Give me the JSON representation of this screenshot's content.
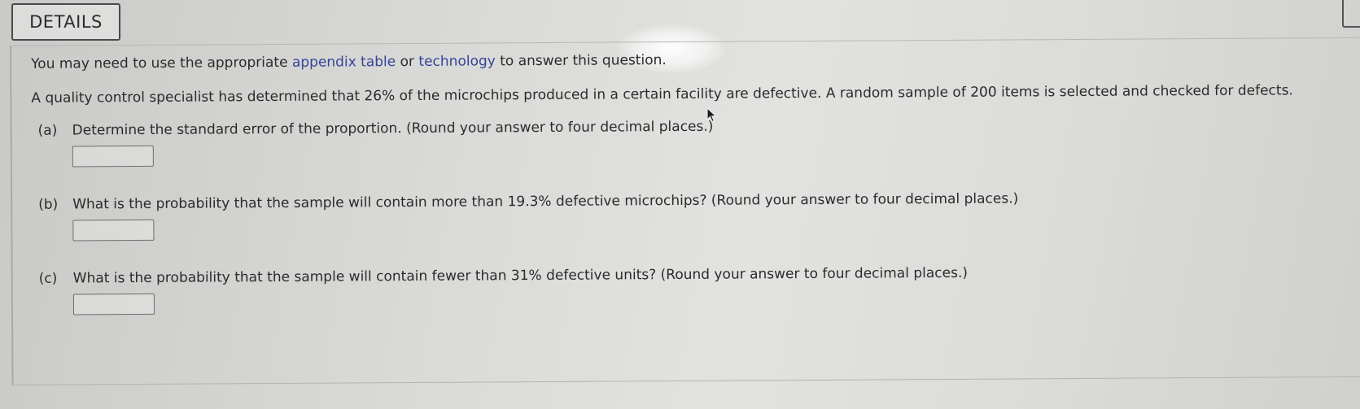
{
  "header": {
    "tab_label": "DETAILS"
  },
  "question": {
    "intro_prefix": "You may need to use the appropriate ",
    "intro_link_1": "appendix table",
    "intro_middle": " or ",
    "intro_link_2": "technology",
    "intro_suffix": " to answer this question.",
    "stem": "A quality control specialist has determined that 26% of the microchips produced in a certain facility are defective. A random sample of 200 items is selected and checked for defects."
  },
  "parts": [
    {
      "label": "(a)",
      "text": "Determine the standard error of the proportion. (Round your answer to four decimal places.)",
      "answer": ""
    },
    {
      "label": "(b)",
      "text": "What is the probability that the sample will contain more than 19.3% defective microchips? (Round your answer to four decimal places.)",
      "answer": ""
    },
    {
      "label": "(c)",
      "text": "What is the probability that the sample will contain fewer than 31% defective units? (Round your answer to four decimal places.)",
      "answer": ""
    }
  ],
  "icons": {
    "cursor": "mouse-pointer-icon"
  },
  "colors": {
    "link": "#34449a",
    "text": "#2b2b2b",
    "background": "#d8d8d6"
  }
}
